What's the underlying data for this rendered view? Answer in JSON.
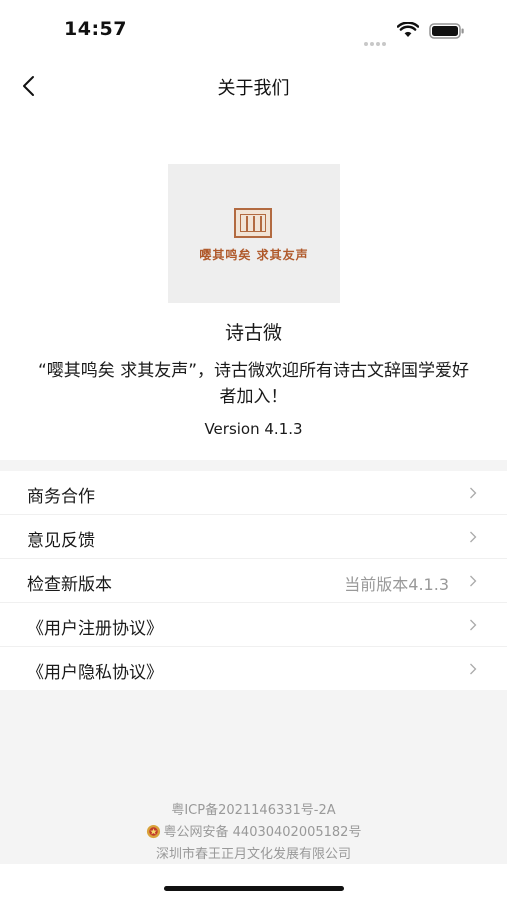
{
  "status_bar": {
    "time": "14:57"
  },
  "nav": {
    "title": "关于我们"
  },
  "about": {
    "logo_slogan": "嘤其鸣矣 求其友声",
    "app_name": "诗古微",
    "description": "“嘤其鸣矣 求其友声”，诗古微欢迎所有诗古文辞国学爱好者加入！",
    "version": "Version 4.1.3"
  },
  "menu": {
    "items": [
      {
        "label": "商务合作",
        "value": ""
      },
      {
        "label": "意见反馈",
        "value": ""
      },
      {
        "label": "检查新版本",
        "value": "当前版本4.1.3"
      },
      {
        "label": "《用户注册协议》",
        "value": ""
      },
      {
        "label": "《用户隐私协议》",
        "value": ""
      }
    ]
  },
  "footer": {
    "icp": "粤ICP备2021146331号-2A",
    "police_record": "粤公网安备 44030402005182号",
    "company": "深圳市春王正月文化发展有限公司"
  },
  "colors": {
    "accent": "#b05a2c",
    "muted": "#999999",
    "background": "#f4f4f4"
  }
}
